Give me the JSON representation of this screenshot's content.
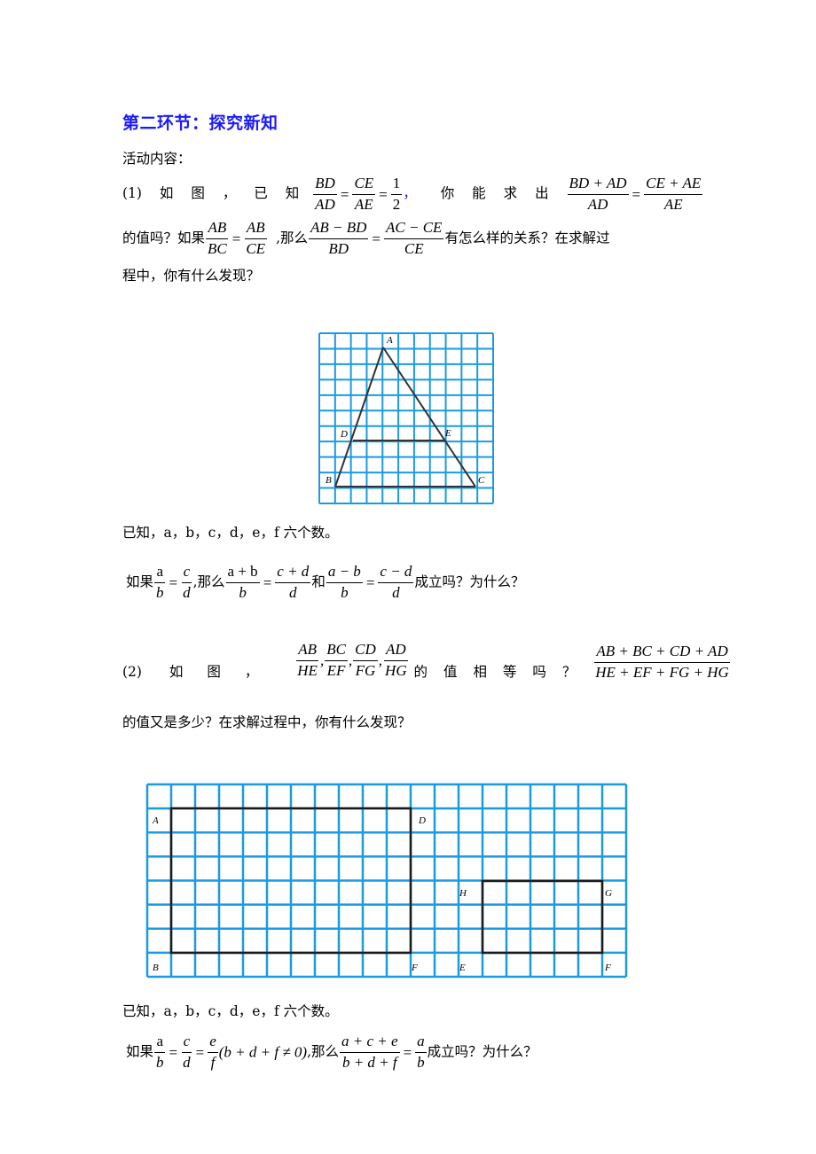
{
  "section_title": "第二环节：探究新知",
  "activity_label": "活动内容：",
  "part1": {
    "prefix": "(1)",
    "words_a": [
      "如",
      "图",
      "，",
      "已",
      "知"
    ],
    "given_fracs": [
      {
        "num": "BD",
        "den": "AD"
      },
      {
        "num": "CE",
        "den": "AE"
      },
      {
        "num": "1",
        "den": "2"
      }
    ],
    "given_comma": "，",
    "words_b": [
      "你",
      "能",
      "求",
      "出"
    ],
    "find_fracs": [
      {
        "num": "BD + AD",
        "den": "AD"
      },
      {
        "num": "CE + AE",
        "den": "AE"
      }
    ],
    "line2_a": "的值吗？如果",
    "if_fracs": [
      {
        "num": "AB",
        "den": "BC"
      },
      {
        "num": "AB",
        "den": "CE"
      }
    ],
    "line2_b": ",那么",
    "then_fracs": [
      {
        "num": "AB − BD",
        "den": "BD"
      },
      {
        "num": "AC − CE",
        "den": "CE"
      }
    ],
    "line2_c": "有怎么样的关系？在求解过",
    "line3": "程中，你有什么发现？"
  },
  "triangle_figure": {
    "grid_color": "#1a9be0",
    "grid_cols": 11,
    "grid_rows": 11,
    "points": {
      "A": {
        "label": "A"
      },
      "B": {
        "label": "B"
      },
      "C": {
        "label": "C"
      },
      "D": {
        "label": "D"
      },
      "E": {
        "label": "E"
      }
    }
  },
  "known1": "已知，a，b，c，d，e，f 六个数。",
  "question1": {
    "prefix": "如果",
    "f1": {
      "num": "a",
      "den": "b"
    },
    "f2": {
      "num": "c",
      "den": "d"
    },
    "mid": ",那么",
    "f3": {
      "num": "a + b",
      "den": "b"
    },
    "f4": {
      "num": "c + d",
      "den": "d"
    },
    "and": "和",
    "f5": {
      "num": "a − b",
      "den": "b"
    },
    "f6": {
      "num": "c − d",
      "den": "d"
    },
    "suffix": "成立吗？为什么？"
  },
  "part2": {
    "words_a": [
      "(2)",
      "如",
      "图",
      "，"
    ],
    "ratio_fracs": [
      {
        "num": "AB",
        "den": "HE"
      },
      {
        "num": "BC",
        "den": "EF"
      },
      {
        "num": "CD",
        "den": "FG"
      },
      {
        "num": "AD",
        "den": "HG"
      }
    ],
    "words_b": [
      "的",
      "值",
      "相",
      "等",
      "吗",
      "？"
    ],
    "sum_frac": {
      "num": "AB + BC + CD + AD",
      "den": "HE + EF + FG + HG"
    },
    "line2": "的值又是多少？在求解过程中，你有什么发现？"
  },
  "rect_figure": {
    "grid_color": "#1a9be0",
    "grid_cols": 20,
    "grid_rows": 8,
    "labels": {
      "A": "A",
      "B": "B",
      "D": "D",
      "C_bottom": "F",
      "H": "H",
      "G": "G",
      "E": "E",
      "F": "F"
    }
  },
  "known2": "已知，a，b，c，d，e，f 六个数。",
  "question2": {
    "prefix": "如果",
    "f1": {
      "num": "a",
      "den": "b"
    },
    "f2": {
      "num": "c",
      "den": "d"
    },
    "f3": {
      "num": "e",
      "den": "f"
    },
    "cond": "(b + d + f ≠ 0)",
    "mid": ",那么",
    "f4": {
      "num": "a + c + e",
      "den": "b + d + f"
    },
    "f5": {
      "num": "a",
      "den": "b"
    },
    "suffix": "成立吗？为什么？"
  }
}
